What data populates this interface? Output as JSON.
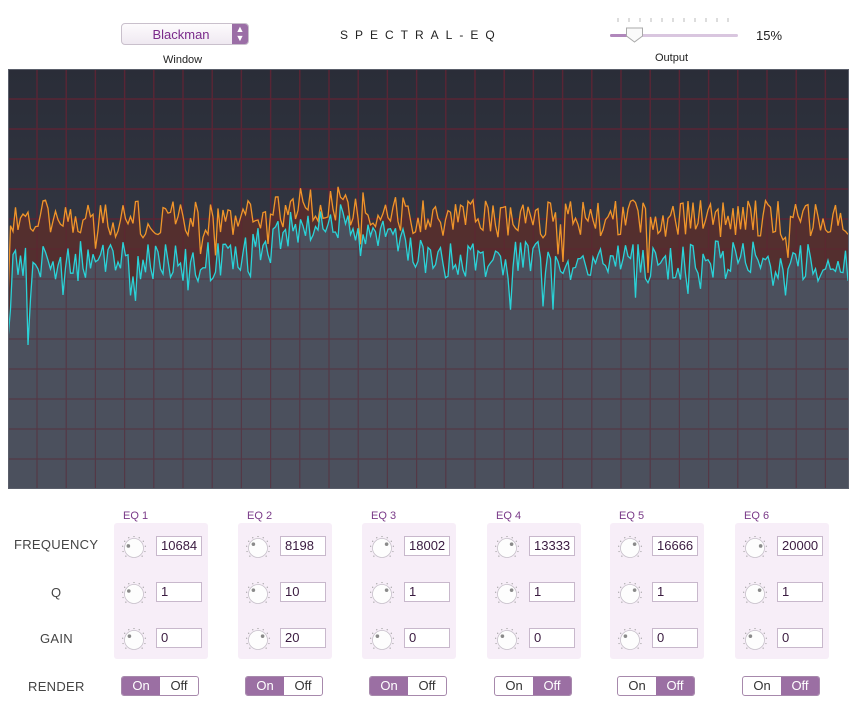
{
  "header": {
    "window_select_value": "Blackman",
    "window_label": "Window",
    "title": "SPECTRAL-EQ",
    "output_label": "Output",
    "output_value": "15%",
    "output_level": 0.15
  },
  "eq_section": {
    "row_labels": {
      "frequency": "FREQUENCY",
      "q": "Q",
      "gain": "GAIN",
      "render": "RENDER"
    },
    "toggle_on": "On",
    "toggle_off": "Off",
    "bands": [
      {
        "title": "EQ 1",
        "frequency": "10684",
        "q": "1",
        "gain": "0",
        "render": "On"
      },
      {
        "title": "EQ 2",
        "frequency": "8198",
        "q": "10",
        "gain": "20",
        "render": "On"
      },
      {
        "title": "EQ 3",
        "frequency": "18002",
        "q": "1",
        "gain": "0",
        "render": "On"
      },
      {
        "title": "EQ 4",
        "frequency": "13333",
        "q": "1",
        "gain": "0",
        "render": "Off"
      },
      {
        "title": "EQ 5",
        "frequency": "16666",
        "q": "1",
        "gain": "0",
        "render": "Off"
      },
      {
        "title": "EQ 6",
        "frequency": "20000",
        "q": "1",
        "gain": "0",
        "render": "Off"
      }
    ]
  },
  "colors": {
    "accent": "#9b6fa3",
    "spectrum_bg": "#2f3340",
    "grid": "#6a2a3a",
    "series_orange": "#f0952a",
    "series_cyan": "#2ad3d8"
  }
}
